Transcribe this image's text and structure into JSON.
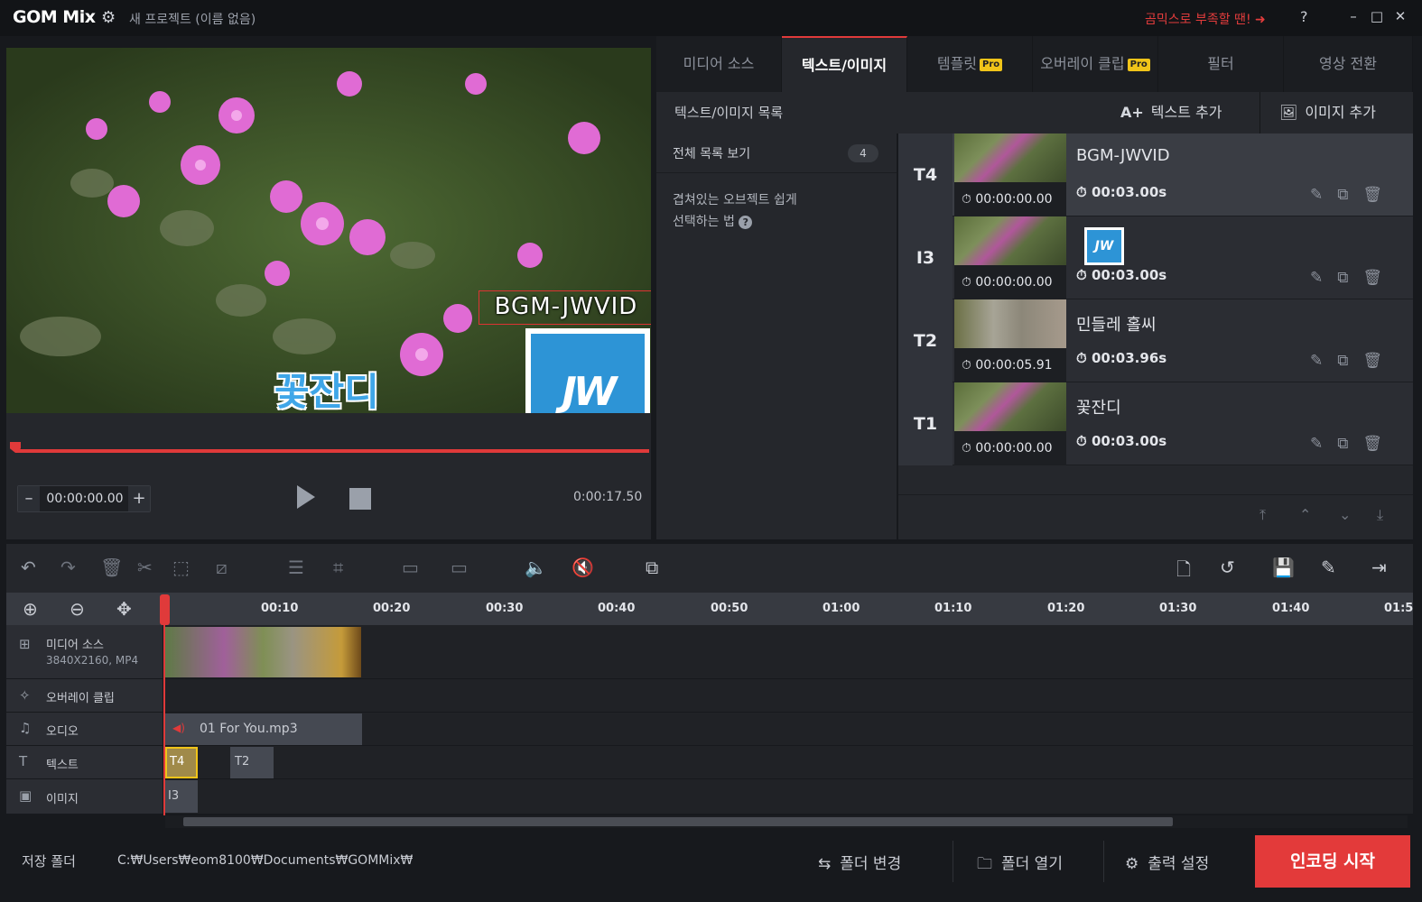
{
  "window": {
    "logo_main": "GOM",
    "logo_sub": "Mix",
    "project_title": "새 프로젝트 (이름 없음)",
    "promo_text": "곰믹스로 부족할 땐! ➜",
    "help": "?",
    "minimize": "–",
    "maximize": "□",
    "close": "✕"
  },
  "preview": {
    "overlay_text_1": "BGM-JWVID",
    "overlay_text_2": "꽃잔디",
    "logo_text": "JW",
    "current_time": "00:00:00.00",
    "total_time": "0:00:17.50",
    "minus": "–",
    "plus": "+"
  },
  "tabs": [
    {
      "label": "미디어 소스",
      "pro": ""
    },
    {
      "label": "텍스트/이미지",
      "pro": ""
    },
    {
      "label": "템플릿",
      "pro": "Pro"
    },
    {
      "label": "오버레이 클립",
      "pro": "Pro"
    },
    {
      "label": "필터",
      "pro": ""
    },
    {
      "label": "영상 전환",
      "pro": ""
    }
  ],
  "list": {
    "title": "텍스트/이미지 목록",
    "add_text": "텍스트 추가",
    "add_image": "이미지 추가",
    "all_view": "전체 목록 보기",
    "count": "4",
    "tip_line1": "겹쳐있는 오브젝트 쉽게",
    "tip_line2": "선택하는 법",
    "tip_icon": "?",
    "items": [
      {
        "id": "T4",
        "name": "BGM-JWVID",
        "start": "00:00:00.00",
        "duration": "00:03.00s"
      },
      {
        "id": "I3",
        "name": "",
        "start": "00:00:00.00",
        "duration": "00:03.00s"
      },
      {
        "id": "T2",
        "name": "민들레 홀씨",
        "start": "00:00:05.91",
        "duration": "00:03.96s"
      },
      {
        "id": "T1",
        "name": "꽃잔디",
        "start": "00:00:00.00",
        "duration": "00:03.00s"
      }
    ]
  },
  "timeline": {
    "ruler": [
      "00:10",
      "00:20",
      "00:30",
      "00:40",
      "00:50",
      "01:00",
      "01:10",
      "01:20",
      "01:30",
      "01:40",
      "01:5"
    ],
    "tracks": [
      {
        "label": "미디어 소스",
        "sub": "3840X2160, MP4"
      },
      {
        "label": "오버레이 클립",
        "sub": ""
      },
      {
        "label": "오디오",
        "sub": ""
      },
      {
        "label": "텍스트",
        "sub": ""
      },
      {
        "label": "이미지",
        "sub": ""
      }
    ],
    "audio_clip": "01 For You.mp3",
    "text_clip_1": "T4",
    "text_clip_2": "T2",
    "image_clip": "I3"
  },
  "bottom": {
    "save_folder_label": "저장 폴더",
    "path": "C:₩Users₩eom8100₩Documents₩GOMMix₩",
    "change_folder": "폴더 변경",
    "open_folder": "폴더 열기",
    "output_settings": "출력 설정",
    "encode": "인코딩 시작"
  },
  "colors": {
    "accent": "#e33a3a",
    "pro_badge": "#f0c419",
    "text_logo_blue": "#2d94d6"
  }
}
